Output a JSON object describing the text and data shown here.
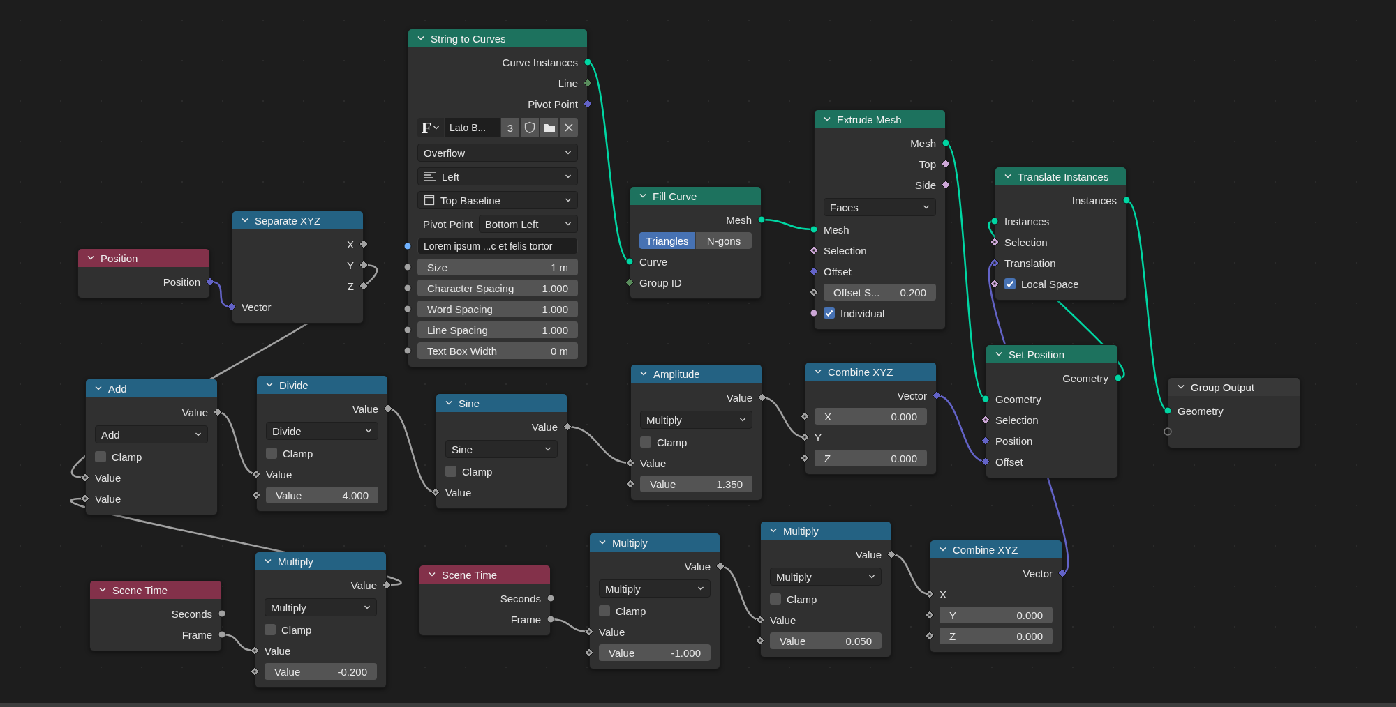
{
  "nodes": [
    {
      "title": "Position",
      "kind": "input",
      "rows": [
        {
          "kind": "output",
          "label": "Position",
          "socket": {
            "kind": "diamond",
            "color": "#6363c7"
          }
        }
      ]
    },
    {
      "title": "Separate XYZ",
      "kind": "converter",
      "rows": [
        {
          "kind": "output",
          "label": "X",
          "socket": {
            "kind": "diamond",
            "color": "#a1a1a1"
          }
        },
        {
          "kind": "output",
          "label": "Y",
          "socket": {
            "kind": "diamond",
            "color": "#a1a1a1"
          }
        },
        {
          "kind": "output",
          "label": "Z",
          "socket": {
            "kind": "diamond",
            "color": "#a1a1a1"
          }
        },
        {
          "kind": "input",
          "label": "Vector",
          "linked": true,
          "socket": {
            "kind": "diamond",
            "color": "#6363c7"
          }
        }
      ]
    },
    {
      "title": "String to Curves",
      "kind": "geometry",
      "rows": [
        {
          "kind": "output",
          "label": "Curve Instances",
          "socket": {
            "kind": "circle",
            "color": "#00d6a3"
          }
        },
        {
          "kind": "output",
          "label": "Line",
          "socket": {
            "kind": "diamond",
            "color": "#598c5c"
          }
        },
        {
          "kind": "output",
          "label": "Pivot Point",
          "socket": {
            "kind": "diamond",
            "color": "#6363c7"
          }
        },
        {
          "kind": "font",
          "glyph": "F",
          "name": "Lato B...",
          "users": "3"
        },
        {
          "kind": "dropdown",
          "value": "Overflow"
        },
        {
          "kind": "dropdown_align",
          "value": "Left"
        },
        {
          "kind": "dropdown_frame",
          "value": "Top Baseline"
        },
        {
          "kind": "labeled_dropdown",
          "label": "Pivot Point",
          "value": "Bottom Left"
        },
        {
          "kind": "text",
          "value": "Lorem ipsum ...c et felis tortor",
          "socket": {
            "kind": "circle",
            "color": "#70b2ff"
          }
        },
        {
          "kind": "value",
          "label": "Size",
          "value": "1 m",
          "socket": {
            "kind": "circle",
            "color": "#a1a1a1"
          }
        },
        {
          "kind": "value",
          "label": "Character Spacing",
          "value": "1.000",
          "socket": {
            "kind": "circle",
            "color": "#a1a1a1"
          }
        },
        {
          "kind": "value",
          "label": "Word Spacing",
          "value": "1.000",
          "socket": {
            "kind": "circle",
            "color": "#a1a1a1"
          }
        },
        {
          "kind": "value",
          "label": "Line Spacing",
          "value": "1.000",
          "socket": {
            "kind": "circle",
            "color": "#a1a1a1"
          }
        },
        {
          "kind": "value",
          "label": "Text Box Width",
          "value": "0 m",
          "socket": {
            "kind": "circle",
            "color": "#a1a1a1"
          }
        }
      ]
    },
    {
      "title": "Fill Curve",
      "kind": "geometry",
      "rows": [
        {
          "kind": "output",
          "label": "Mesh",
          "socket": {
            "kind": "circle",
            "color": "#00d6a3"
          }
        },
        {
          "kind": "toggle",
          "options": [
            {
              "label": "Triangles",
              "selected": true
            },
            {
              "label": "N-gons",
              "selected": false
            }
          ]
        },
        {
          "kind": "input",
          "label": "Curve",
          "linked": true,
          "socket": {
            "kind": "circle",
            "color": "#00d6a3"
          }
        },
        {
          "kind": "input",
          "label": "Group ID",
          "socket": {
            "kind": "diamond",
            "color": "#598c5c"
          }
        }
      ]
    },
    {
      "title": "Extrude Mesh",
      "kind": "geometry",
      "rows": [
        {
          "kind": "output",
          "label": "Mesh",
          "socket": {
            "kind": "circle",
            "color": "#00d6a3"
          }
        },
        {
          "kind": "output",
          "label": "Top",
          "socket": {
            "kind": "diamond",
            "color": "#cca6d6"
          }
        },
        {
          "kind": "output",
          "label": "Side",
          "socket": {
            "kind": "diamond",
            "color": "#cca6d6"
          }
        },
        {
          "kind": "dropdown",
          "value": "Faces"
        },
        {
          "kind": "input",
          "label": "Mesh",
          "linked": true,
          "socket": {
            "kind": "circle",
            "color": "#00d6a3"
          }
        },
        {
          "kind": "input",
          "label": "Selection",
          "socket": {
            "kind": "diamond_dot",
            "color": "#cca6d6"
          }
        },
        {
          "kind": "input",
          "label": "Offset",
          "socket": {
            "kind": "diamond",
            "color": "#6363c7"
          }
        },
        {
          "kind": "value",
          "label": "Offset S...",
          "value": "0.200",
          "socket": {
            "kind": "diamond_dot",
            "color": "#a1a1a1"
          }
        },
        {
          "kind": "checkbox",
          "label": "Individual",
          "checked": true,
          "socket": {
            "kind": "circle",
            "color": "#cca6d6"
          }
        }
      ]
    },
    {
      "title": "Translate Instances",
      "kind": "geometry",
      "rows": [
        {
          "kind": "output",
          "label": "Instances",
          "socket": {
            "kind": "circle",
            "color": "#00d6a3"
          }
        },
        {
          "kind": "input",
          "label": "Instances",
          "linked": true,
          "socket": {
            "kind": "circle",
            "color": "#00d6a3"
          }
        },
        {
          "kind": "input",
          "label": "Selection",
          "socket": {
            "kind": "diamond_dot",
            "color": "#cca6d6"
          }
        },
        {
          "kind": "input",
          "label": "Translation",
          "linked": true,
          "socket": {
            "kind": "diamond_dot",
            "color": "#6363c7"
          }
        },
        {
          "kind": "checkbox",
          "label": "Local Space",
          "checked": true,
          "socket": {
            "kind": "diamond_dot",
            "color": "#cca6d6"
          }
        }
      ]
    },
    {
      "title": "Add",
      "kind": "converter",
      "rows": [
        {
          "kind": "output",
          "label": "Value",
          "socket": {
            "kind": "diamond",
            "color": "#a1a1a1"
          }
        },
        {
          "kind": "dropdown",
          "value": "Add"
        },
        {
          "kind": "checkbox",
          "label": "Clamp",
          "checked": false
        },
        {
          "kind": "input",
          "label": "Value",
          "linked": true,
          "socket": {
            "kind": "diamond_dot",
            "color": "#a1a1a1"
          }
        },
        {
          "kind": "input",
          "label": "Value",
          "linked": true,
          "socket": {
            "kind": "diamond_dot",
            "color": "#a1a1a1"
          }
        }
      ]
    },
    {
      "title": "Divide",
      "kind": "converter",
      "rows": [
        {
          "kind": "output",
          "label": "Value",
          "socket": {
            "kind": "diamond",
            "color": "#a1a1a1"
          }
        },
        {
          "kind": "dropdown",
          "value": "Divide"
        },
        {
          "kind": "checkbox",
          "label": "Clamp",
          "checked": false
        },
        {
          "kind": "input",
          "label": "Value",
          "linked": true,
          "socket": {
            "kind": "diamond_dot",
            "color": "#a1a1a1"
          }
        },
        {
          "kind": "value",
          "label": "Value",
          "value": "4.000",
          "socket": {
            "kind": "diamond_dot",
            "color": "#a1a1a1"
          }
        }
      ]
    },
    {
      "title": "Sine",
      "kind": "converter",
      "rows": [
        {
          "kind": "output",
          "label": "Value",
          "socket": {
            "kind": "diamond",
            "color": "#a1a1a1"
          }
        },
        {
          "kind": "dropdown",
          "value": "Sine"
        },
        {
          "kind": "checkbox",
          "label": "Clamp",
          "checked": false
        },
        {
          "kind": "input",
          "label": "Value",
          "linked": true,
          "socket": {
            "kind": "diamond_dot",
            "color": "#a1a1a1"
          }
        }
      ]
    },
    {
      "title": "Amplitude",
      "kind": "converter",
      "rows": [
        {
          "kind": "output",
          "label": "Value",
          "socket": {
            "kind": "diamond",
            "color": "#a1a1a1"
          }
        },
        {
          "kind": "dropdown",
          "value": "Multiply"
        },
        {
          "kind": "checkbox",
          "label": "Clamp",
          "checked": false
        },
        {
          "kind": "input",
          "label": "Value",
          "linked": true,
          "socket": {
            "kind": "diamond_dot",
            "color": "#a1a1a1"
          }
        },
        {
          "kind": "value",
          "label": "Value",
          "value": "1.350",
          "socket": {
            "kind": "diamond_dot",
            "color": "#a1a1a1"
          }
        }
      ]
    },
    {
      "title": "Combine XYZ",
      "kind": "converter",
      "rows": [
        {
          "kind": "output",
          "label": "Vector",
          "socket": {
            "kind": "diamond",
            "color": "#6363c7"
          }
        },
        {
          "kind": "value",
          "label": "X",
          "value": "0.000",
          "socket": {
            "kind": "diamond_dot",
            "color": "#a1a1a1"
          }
        },
        {
          "kind": "input",
          "label": "Y",
          "linked": true,
          "socket": {
            "kind": "diamond_dot",
            "color": "#a1a1a1"
          }
        },
        {
          "kind": "value",
          "label": "Z",
          "value": "0.000",
          "socket": {
            "kind": "diamond_dot",
            "color": "#a1a1a1"
          }
        }
      ]
    },
    {
      "title": "Set Position",
      "kind": "geometry",
      "rows": [
        {
          "kind": "output",
          "label": "Geometry",
          "socket": {
            "kind": "circle",
            "color": "#00d6a3"
          }
        },
        {
          "kind": "input",
          "label": "Geometry",
          "linked": true,
          "socket": {
            "kind": "circle",
            "color": "#00d6a3"
          }
        },
        {
          "kind": "input",
          "label": "Selection",
          "socket": {
            "kind": "diamond_dot",
            "color": "#cca6d6"
          }
        },
        {
          "kind": "input",
          "label": "Position",
          "socket": {
            "kind": "diamond",
            "color": "#6363c7"
          }
        },
        {
          "kind": "input",
          "label": "Offset",
          "linked": true,
          "socket": {
            "kind": "diamond",
            "color": "#6363c7"
          }
        }
      ]
    },
    {
      "title": "Group Output",
      "kind": "output",
      "rows": [
        {
          "kind": "input",
          "label": "Geometry",
          "linked": true,
          "socket": {
            "kind": "circle",
            "color": "#00d6a3"
          }
        },
        {
          "kind": "empty",
          "socket": {
            "kind": "hollow"
          }
        }
      ]
    },
    {
      "title": "Scene Time",
      "kind": "input",
      "rows": [
        {
          "kind": "output",
          "label": "Seconds",
          "socket": {
            "kind": "circle",
            "color": "#a1a1a1"
          }
        },
        {
          "kind": "output",
          "label": "Frame",
          "socket": {
            "kind": "circle",
            "color": "#a1a1a1"
          }
        }
      ]
    },
    {
      "title": "Multiply",
      "kind": "converter",
      "rows": [
        {
          "kind": "output",
          "label": "Value",
          "socket": {
            "kind": "diamond",
            "color": "#a1a1a1"
          }
        },
        {
          "kind": "dropdown",
          "value": "Multiply"
        },
        {
          "kind": "checkbox",
          "label": "Clamp",
          "checked": false
        },
        {
          "kind": "input",
          "label": "Value",
          "linked": true,
          "socket": {
            "kind": "diamond_dot",
            "color": "#a1a1a1"
          }
        },
        {
          "kind": "value",
          "label": "Value",
          "value": "-0.200",
          "socket": {
            "kind": "diamond_dot",
            "color": "#a1a1a1"
          }
        }
      ]
    },
    {
      "title": "Scene Time",
      "kind": "input",
      "rows": [
        {
          "kind": "output",
          "label": "Seconds",
          "socket": {
            "kind": "circle",
            "color": "#a1a1a1"
          }
        },
        {
          "kind": "output",
          "label": "Frame",
          "socket": {
            "kind": "circle",
            "color": "#a1a1a1"
          }
        }
      ]
    },
    {
      "title": "Multiply",
      "kind": "converter",
      "rows": [
        {
          "kind": "output",
          "label": "Value",
          "socket": {
            "kind": "diamond",
            "color": "#a1a1a1"
          }
        },
        {
          "kind": "dropdown",
          "value": "Multiply"
        },
        {
          "kind": "checkbox",
          "label": "Clamp",
          "checked": false
        },
        {
          "kind": "input",
          "label": "Value",
          "linked": true,
          "socket": {
            "kind": "diamond_dot",
            "color": "#a1a1a1"
          }
        },
        {
          "kind": "value",
          "label": "Value",
          "value": "-1.000",
          "socket": {
            "kind": "diamond_dot",
            "color": "#a1a1a1"
          }
        }
      ]
    },
    {
      "title": "Multiply",
      "kind": "converter",
      "rows": [
        {
          "kind": "output",
          "label": "Value",
          "socket": {
            "kind": "diamond",
            "color": "#a1a1a1"
          }
        },
        {
          "kind": "dropdown",
          "value": "Multiply"
        },
        {
          "kind": "checkbox",
          "label": "Clamp",
          "checked": false
        },
        {
          "kind": "input",
          "label": "Value",
          "linked": true,
          "socket": {
            "kind": "diamond_dot",
            "color": "#a1a1a1"
          }
        },
        {
          "kind": "value",
          "label": "Value",
          "value": "0.050",
          "socket": {
            "kind": "diamond_dot",
            "color": "#a1a1a1"
          }
        }
      ]
    },
    {
      "title": "Combine XYZ",
      "kind": "converter",
      "rows": [
        {
          "kind": "output",
          "label": "Vector",
          "socket": {
            "kind": "diamond",
            "color": "#6363c7"
          }
        },
        {
          "kind": "input",
          "label": "X",
          "linked": true,
          "socket": {
            "kind": "diamond_dot",
            "color": "#a1a1a1"
          }
        },
        {
          "kind": "value",
          "label": "Y",
          "value": "0.000",
          "socket": {
            "kind": "diamond_dot",
            "color": "#a1a1a1"
          }
        },
        {
          "kind": "value",
          "label": "Z",
          "value": "0.000",
          "socket": {
            "kind": "diamond_dot",
            "color": "#a1a1a1"
          }
        }
      ]
    }
  ]
}
